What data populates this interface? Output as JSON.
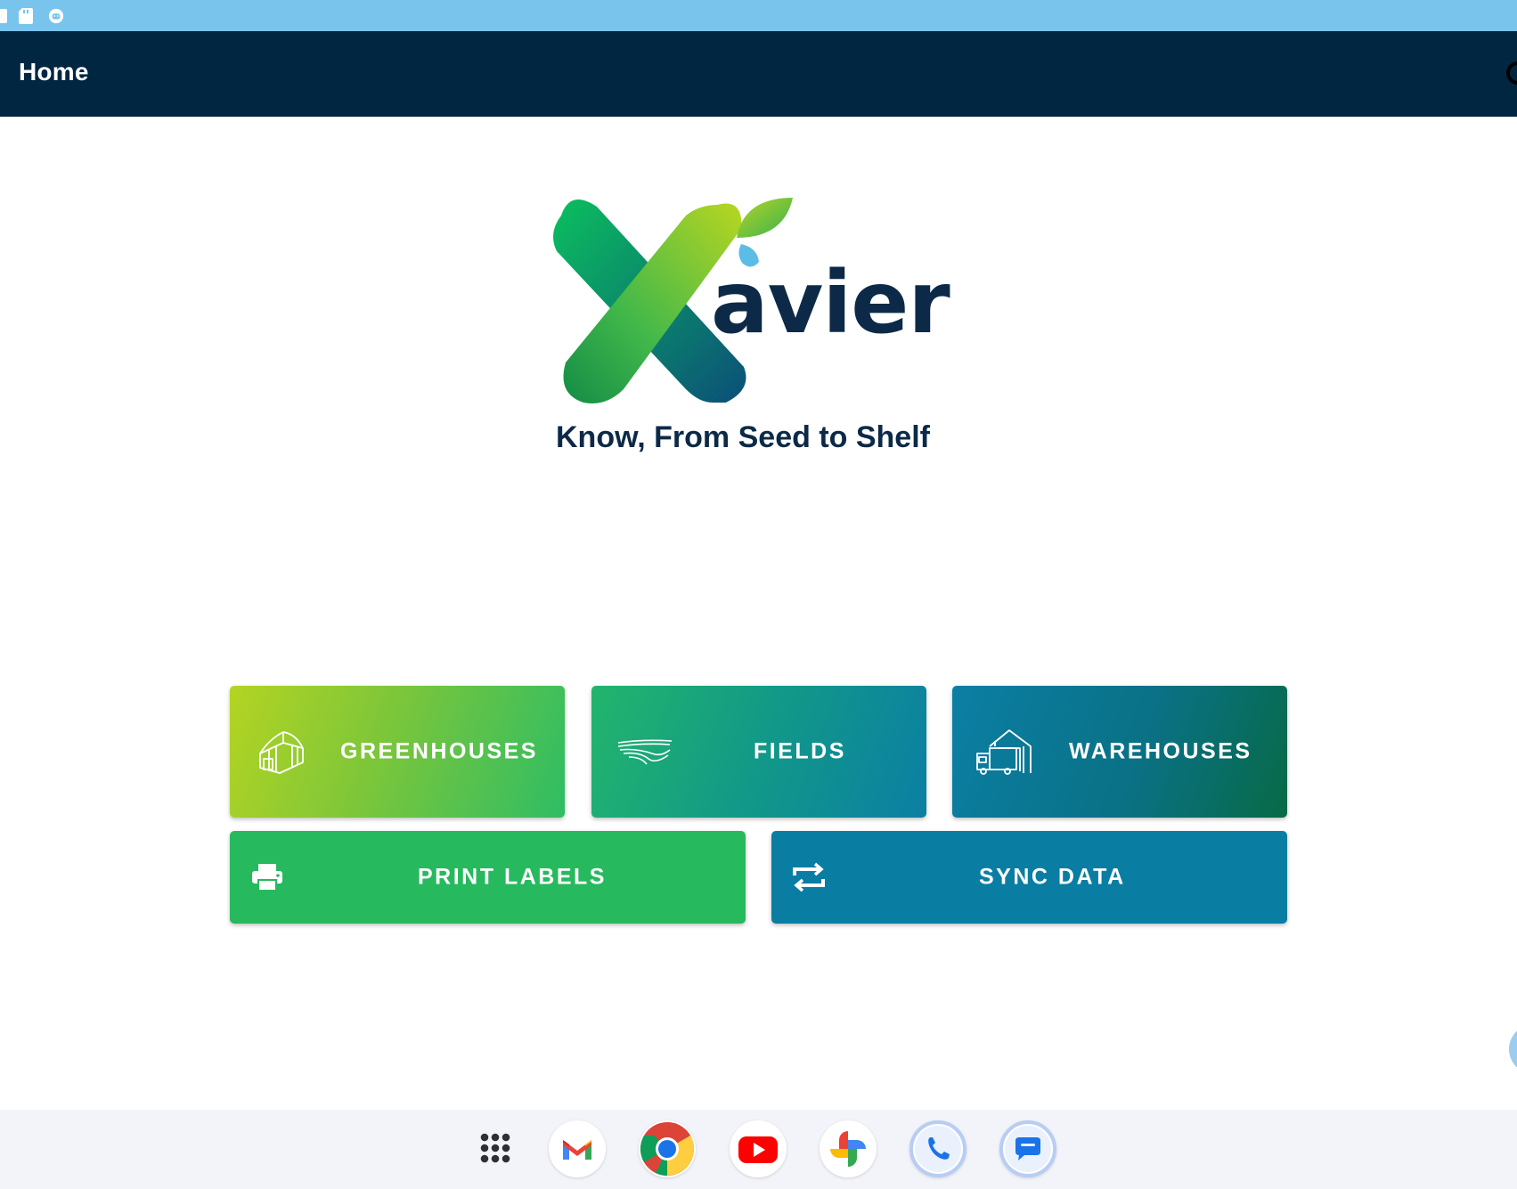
{
  "app_bar": {
    "title": "Home"
  },
  "logo": {
    "wordmark": "avier",
    "tagline": "Know, From Seed to Shelf"
  },
  "tiles": [
    {
      "label": "GREENHOUSES",
      "icon": "greenhouse-icon"
    },
    {
      "label": "FIELDS",
      "icon": "field-icon"
    },
    {
      "label": "WAREHOUSES",
      "icon": "warehouse-truck-icon"
    },
    {
      "label": "PRINT LABELS",
      "icon": "printer-icon"
    },
    {
      "label": "SYNC DATA",
      "icon": "sync-icon"
    }
  ],
  "taskbar": {
    "apps": [
      "app-drawer-icon",
      "gmail-icon",
      "chrome-icon",
      "youtube-icon",
      "photos-icon",
      "phone-icon",
      "messages-icon"
    ]
  },
  "colors": {
    "status_bar": "#78c4ec",
    "app_bar": "#012642",
    "brand_navy": "#0c2a47",
    "print_green": "#27b95e",
    "sync_blue": "#0a7da3"
  }
}
